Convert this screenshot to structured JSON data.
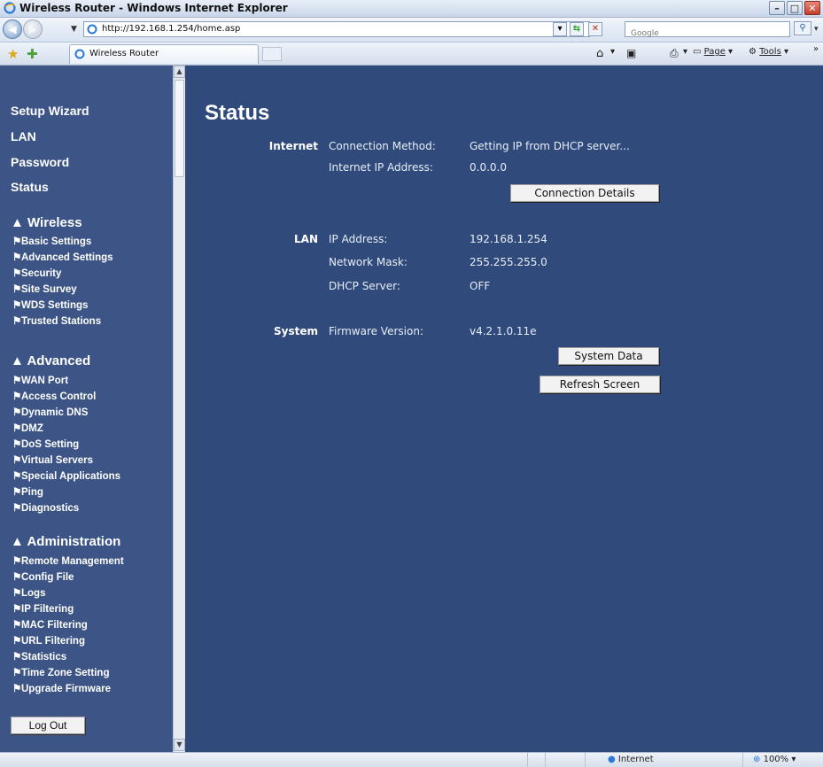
{
  "window": {
    "title": "Wireless Router - Windows Internet Explorer"
  },
  "address_bar": {
    "url": "http://192.168.1.254/home.asp",
    "search_placeholder": "Google"
  },
  "tab": {
    "label": "Wireless Router"
  },
  "toolbar": {
    "page_label": "Page",
    "tools_label": "Tools",
    "more": "»"
  },
  "sidebar": {
    "top_items": [
      "Setup Wizard",
      "LAN",
      "Password",
      "Status"
    ],
    "wireless": {
      "title": "Wireless",
      "items": [
        "Basic Settings",
        "Advanced Settings",
        "Security",
        "Site Survey",
        "WDS Settings",
        "Trusted Stations"
      ]
    },
    "advanced": {
      "title": "Advanced",
      "items": [
        "WAN Port",
        "Access Control",
        "Dynamic DNS",
        "DMZ",
        "DoS Setting",
        "Virtual Servers",
        "Special Applications",
        "Ping",
        "Diagnostics"
      ]
    },
    "administration": {
      "title": "Administration",
      "items": [
        "Remote Management",
        "Config File",
        "Logs",
        "IP Filtering",
        "MAC Filtering",
        "URL Filtering",
        "Statistics",
        "Time Zone Setting",
        "Upgrade Firmware"
      ]
    },
    "logout_label": "Log Out"
  },
  "main": {
    "title": "Status",
    "internet": {
      "section": "Internet",
      "rows": [
        {
          "label": "Connection Method:",
          "value": "Getting IP from DHCP server..."
        },
        {
          "label": "Internet IP Address:",
          "value": "0.0.0.0"
        }
      ],
      "button": "Connection Details"
    },
    "lan": {
      "section": "LAN",
      "rows": [
        {
          "label": "IP Address:",
          "value": "192.168.1.254"
        },
        {
          "label": "Network Mask:",
          "value": "255.255.255.0"
        },
        {
          "label": "DHCP Server:",
          "value": "OFF"
        }
      ]
    },
    "system": {
      "section": "System",
      "rows": [
        {
          "label": "Firmware Version:",
          "value": "v4.2.1.0.11e"
        }
      ],
      "system_data_button": "System Data",
      "refresh_button": "Refresh Screen"
    }
  },
  "statusbar": {
    "zone": "Internet",
    "zoom": "100%"
  },
  "colors": {
    "sidebar_bg": "#3d5586",
    "content_bg": "#2f4a7b",
    "text": "#ffffff"
  }
}
